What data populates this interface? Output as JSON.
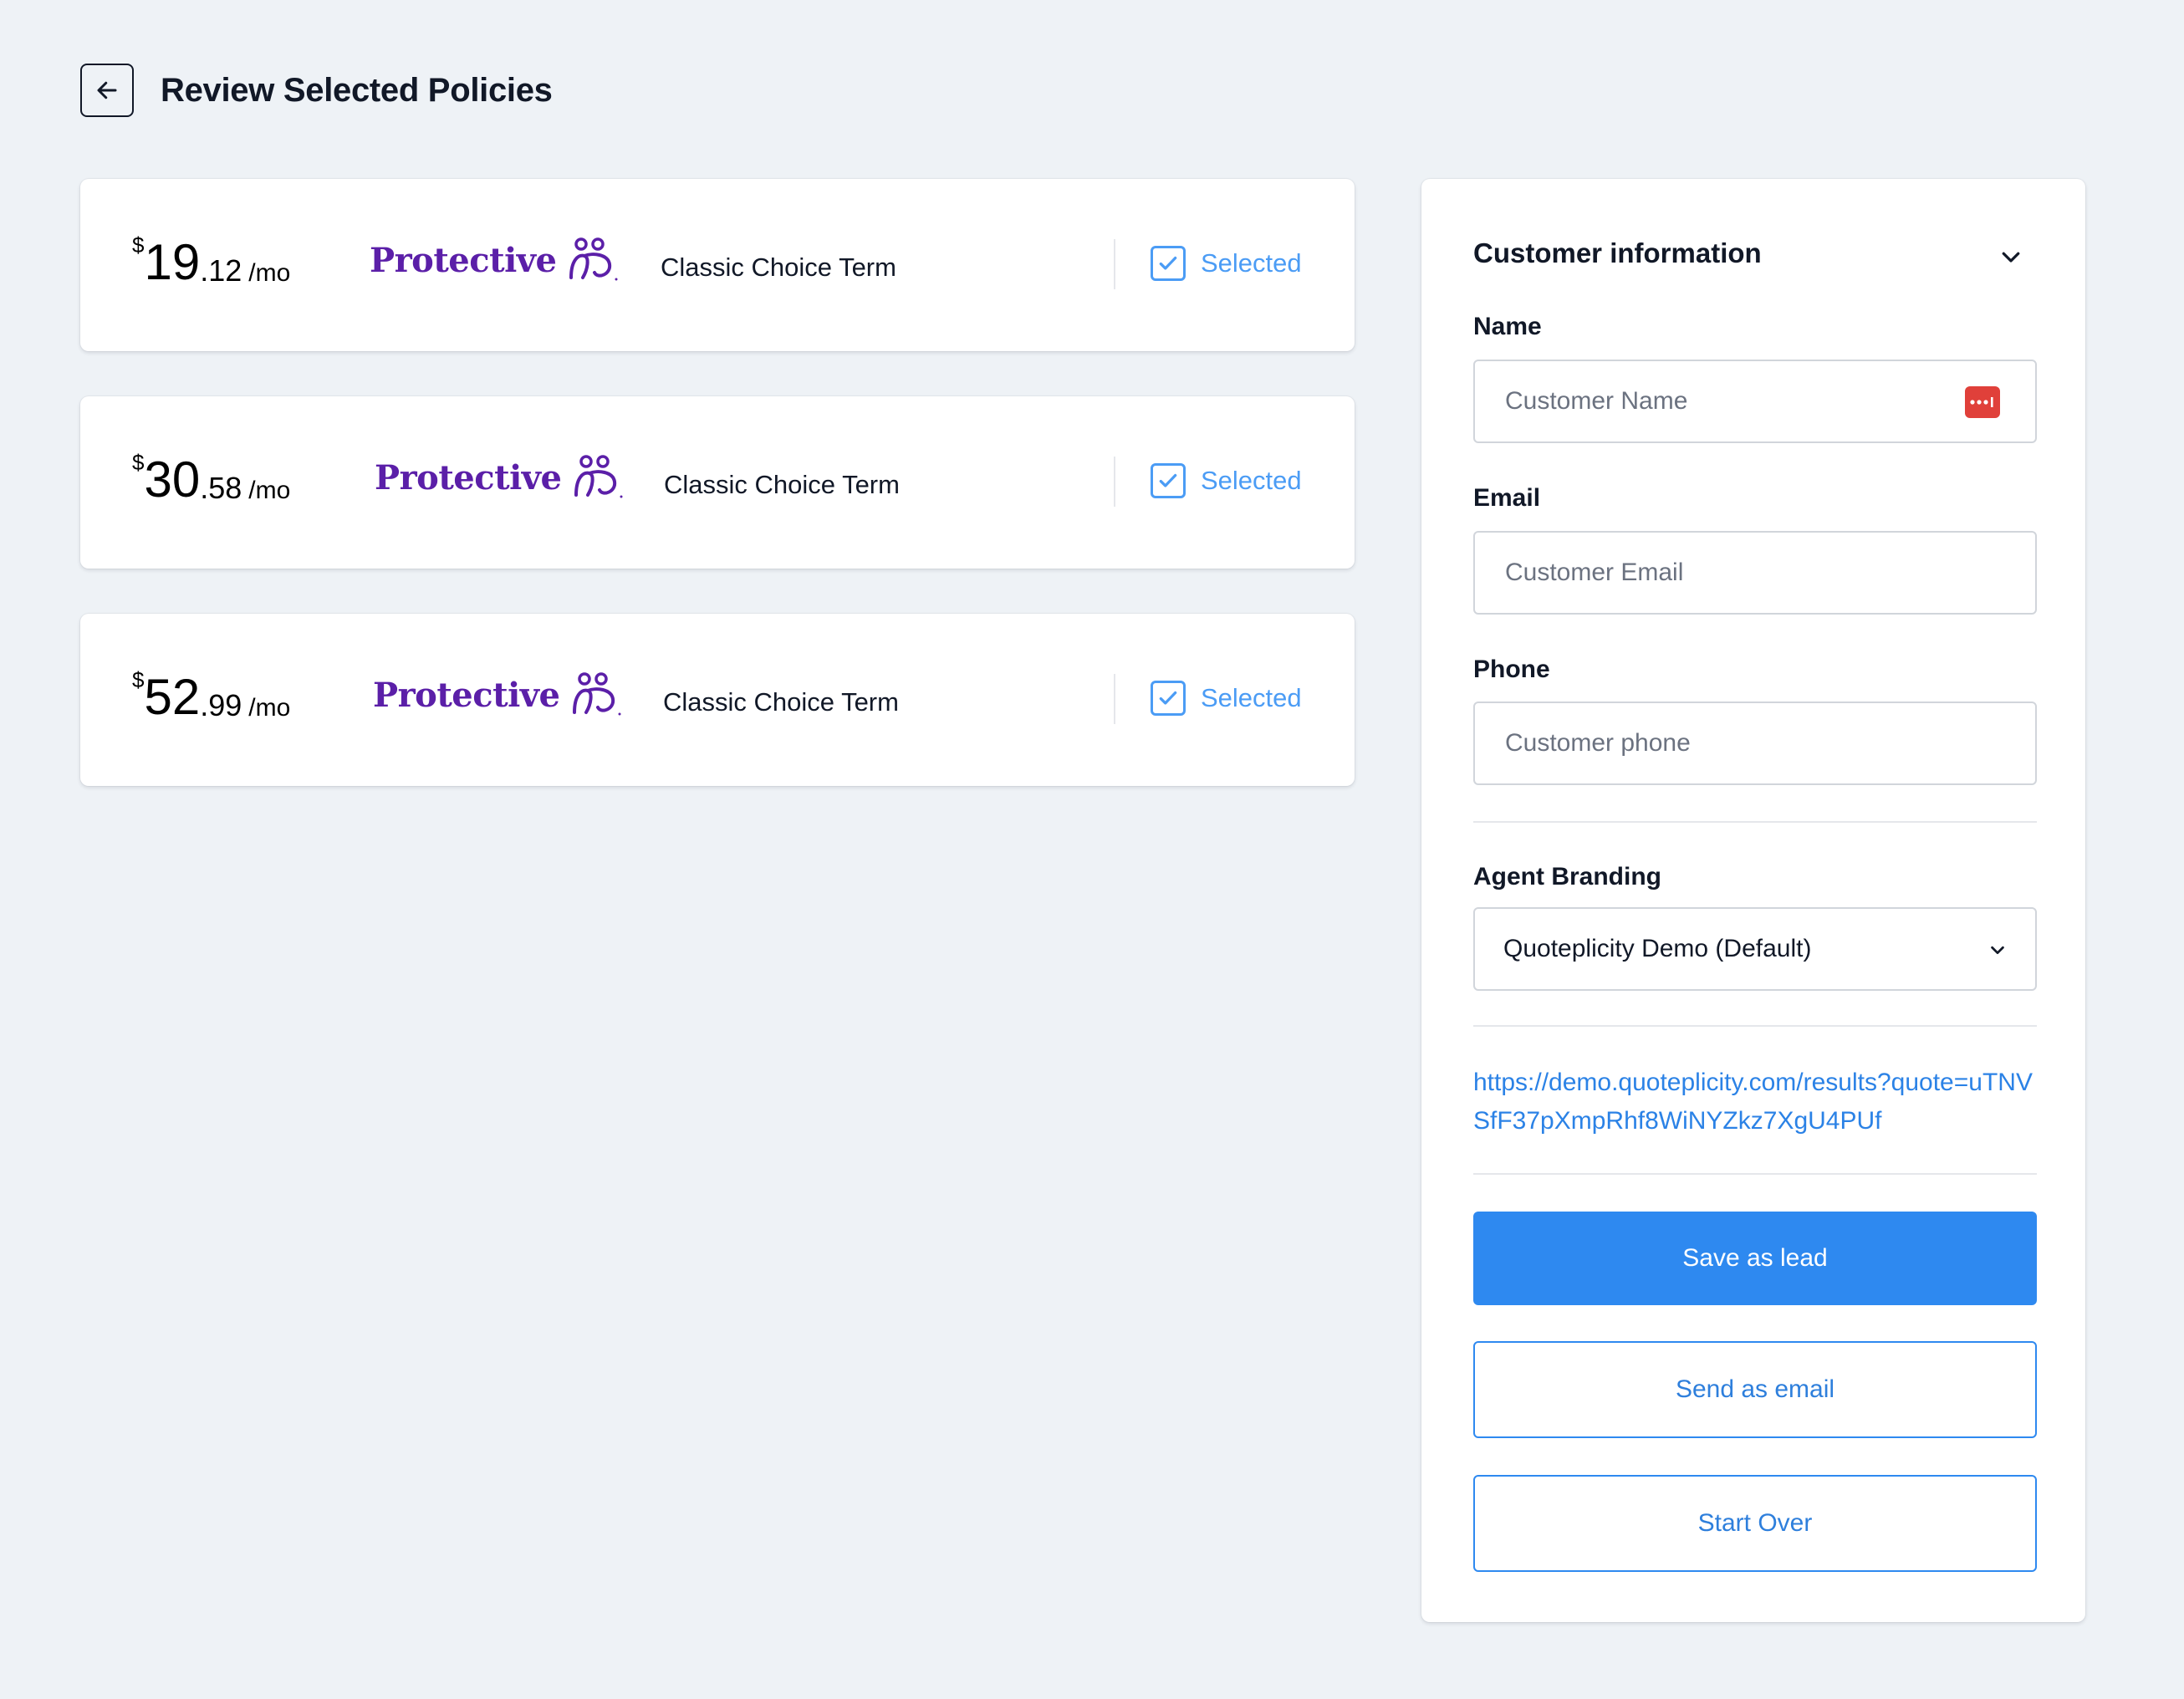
{
  "header": {
    "title": "Review Selected Policies"
  },
  "policies": [
    {
      "price_symbol": "$",
      "price_whole": "19",
      "price_cents": ".12",
      "price_period": "/mo",
      "carrier": "Protective",
      "plan": "Classic Choice Term",
      "status": "Selected"
    },
    {
      "price_symbol": "$",
      "price_whole": "30",
      "price_cents": ".58",
      "price_period": "/mo",
      "carrier": "Protective",
      "plan": "Classic Choice Term",
      "status": "Selected"
    },
    {
      "price_symbol": "$",
      "price_whole": "52",
      "price_cents": ".99",
      "price_period": "/mo",
      "carrier": "Protective",
      "plan": "Classic Choice Term",
      "status": "Selected"
    }
  ],
  "customer_panel": {
    "title": "Customer information",
    "name_label": "Name",
    "name_placeholder": "Customer Name",
    "email_label": "Email",
    "email_placeholder": "Customer Email",
    "phone_label": "Phone",
    "phone_placeholder": "Customer phone",
    "branding_label": "Agent Branding",
    "branding_value": "Quoteplicity Demo (Default)",
    "quote_link": "https://demo.quoteplicity.com/results?quote=uTNVSfF37pXmpRhf8WiNYZkz7XgU4PUf",
    "save_lead_label": "Save as lead",
    "send_email_label": "Send as email",
    "start_over_label": "Start Over"
  },
  "colors": {
    "background": "#eef2f6",
    "brand_purple": "#5b1fa8",
    "accent_blue": "#2e89f0",
    "selected_blue": "#4b9cf5",
    "password_icon_red": "#e0403a"
  },
  "icons": {
    "back": "arrow-left-icon",
    "collapse": "chevron-down-icon",
    "checkbox": "checkmark-icon",
    "password_manager": "password-dots-icon",
    "select": "chevron-down-icon"
  }
}
